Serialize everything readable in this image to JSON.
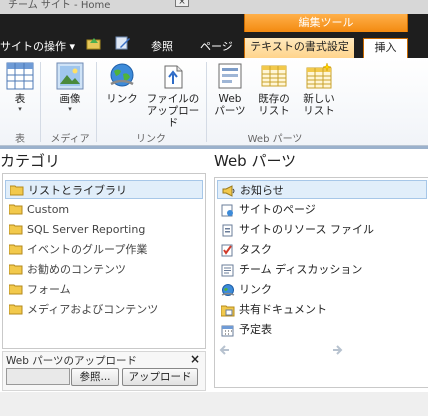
{
  "titlebar": {
    "text": "チーム サイト - Home"
  },
  "topbar": {
    "site_actions": "サイトの操作 ▾",
    "context_group": "編集ツール",
    "tabs": [
      {
        "label": "参照"
      },
      {
        "label": "ページ"
      },
      {
        "label": "テキストの書式設定"
      },
      {
        "label": "挿入"
      }
    ]
  },
  "ribbon": {
    "groups": [
      {
        "label": "表"
      },
      {
        "label": "メディア"
      },
      {
        "label": "リンク"
      },
      {
        "label": "Web パーツ"
      }
    ],
    "buttons": {
      "table": {
        "label": "表",
        "dropdown": "▾"
      },
      "image": {
        "label": "画像",
        "dropdown": "▾"
      },
      "link": {
        "label": "リンク"
      },
      "upload_file": {
        "line1": "ファイルの",
        "line2": "アップロード"
      },
      "web_part": {
        "line1": "Web",
        "line2": "パーツ"
      },
      "existing_list": {
        "line1": "既存の",
        "line2": "リスト"
      },
      "new_list": {
        "line1": "新しい",
        "line2": "リスト"
      }
    }
  },
  "left_panel": {
    "title": "カテゴリ",
    "items": [
      {
        "label": "リストとライブラリ",
        "selected": true
      },
      {
        "label": "Custom",
        "selected": false
      },
      {
        "label": "SQL Server Reporting",
        "selected": false
      },
      {
        "label": "イベントのグループ作業",
        "selected": false
      },
      {
        "label": "お勧めのコンテンツ",
        "selected": false
      },
      {
        "label": "フォーム",
        "selected": false
      },
      {
        "label": "メディアおよびコンテンツ",
        "selected": false
      }
    ]
  },
  "upload_box": {
    "label": "Web パーツのアップロード",
    "close": "×",
    "input_value": "",
    "browse_label": "参照...",
    "upload_label": "アップロード"
  },
  "right_panel": {
    "title": "Web パーツ",
    "items": [
      {
        "label": "お知らせ",
        "icon": "announcement-icon",
        "selected": true
      },
      {
        "label": "サイトのページ",
        "icon": "site-pages-icon",
        "selected": false
      },
      {
        "label": "サイトのリソース ファイル",
        "icon": "resource-file-icon",
        "selected": false
      },
      {
        "label": "タスク",
        "icon": "task-icon",
        "selected": false
      },
      {
        "label": "チーム ディスカッション",
        "icon": "discussion-icon",
        "selected": false
      },
      {
        "label": "リンク",
        "icon": "link-icon",
        "selected": false
      },
      {
        "label": "共有ドキュメント",
        "icon": "shared-docs-icon",
        "selected": false
      },
      {
        "label": "予定表",
        "icon": "calendar-icon",
        "selected": false
      }
    ]
  },
  "colors": {
    "topbar_bg": "#1e1e1e",
    "context_orange": "#f38a10",
    "selection_bg": "#e1eefa",
    "folder_yellow": "#f2c94c"
  }
}
